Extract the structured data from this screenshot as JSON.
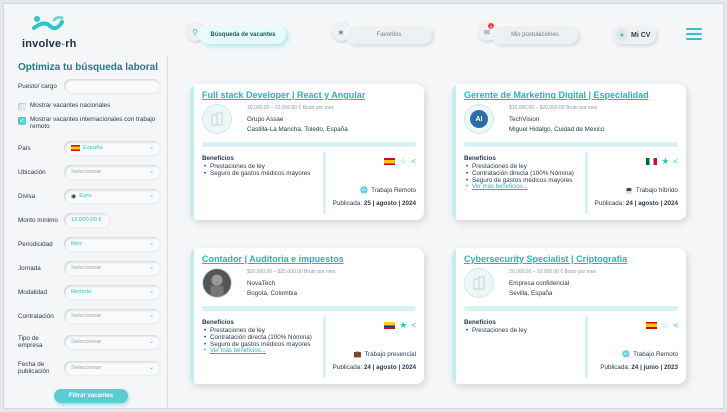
{
  "header": {
    "logo_text": "involve-rh",
    "nav": [
      {
        "label": "Búsqueda de vacantes"
      },
      {
        "label": "Favoritos"
      },
      {
        "label": "Mis postulaciones",
        "badge": "1"
      }
    ],
    "profile_label": "Mi CV"
  },
  "sidebar": {
    "title": "Optimiza tu búsqueda laboral",
    "position_label": "Puesto/ cargo",
    "position_value": "",
    "national_label": "Mostrar vacantes nacionales",
    "international_label": "Mostrar vacantes internacionales con trabajo remoto",
    "country_label": "País",
    "country_value": "España",
    "location_label": "Ubicación",
    "location_value": "Seleccionar",
    "currency_label": "Divisa",
    "currency_value": "Euro",
    "min_amount_label": "Monto mínimo",
    "min_amount_value": "15,000.00 €",
    "periodicity_label": "Periodicidad",
    "periodicity_value": "Mes",
    "shift_label": "Jornada",
    "shift_value": "Seleccionar",
    "modality_label": "Modalidad",
    "modality_value": "Remoto",
    "contract_label": "Contratación",
    "contract_value": "Seleccionar",
    "company_type_label": "Tipo de empresa",
    "company_type_value": "Seleccionar",
    "pub_date_label": "Fecha de publicación",
    "pub_date_value": "Seleccionar",
    "filter_button": "Filtrar vacantes"
  },
  "jobs": [
    {
      "title": "Full stack Developer | React y Angular",
      "salary": "10,000.00 – 20,000.00 € Bruto por mes",
      "company": "Grupo Assae",
      "location": "Castilla-La Mancha, Toledo, España",
      "benefits_title": "Beneficios",
      "benefits": [
        "Prestaciones de ley",
        "Seguro de gastos médicos mayores"
      ],
      "more": "",
      "modality": "Trabajo Remoto",
      "published_label": "Publicada:",
      "published_date": "25 | agosto | 2024",
      "favorite": false
    },
    {
      "title": "Gerente de Marketing Digital | Especialidad",
      "salary": "$15,000.00 – $20,000.00 Bruto por mes",
      "company": "TechVision",
      "location": "Miguel Hidalgo, Cuidad de México",
      "benefits_title": "Beneficios",
      "benefits": [
        "Prestaciones de ley",
        "Contratación directa (100% Nómina)",
        "Seguro de gastos médicos mayores"
      ],
      "more": "Ver más beneficios...",
      "modality": "Trabajo híbrido",
      "published_label": "Publicada:",
      "published_date": "24 | agosto | 2024",
      "favorite": true
    },
    {
      "title": "Contador | Auditoria e impuestos",
      "salary": "$20,000.00 – $25,000.00 Bruto por mes",
      "company": "NovaTech",
      "location": "Bogotá, Colombia",
      "benefits_title": "Beneficios",
      "benefits": [
        "Prestaciones de ley",
        "Contratación directa (100% Nómina)",
        "Seguro de gastos médicos mayores"
      ],
      "more": "Ver más beneficios...",
      "modality": "Trabajo presencial",
      "published_label": "Publicada:",
      "published_date": "24 | agosto | 2024",
      "favorite": true
    },
    {
      "title": "Cybersecurity Specialist | Criptografía",
      "salary": "20,000.00 – 30,000.00 € Bruto por mes",
      "company": "Empresa confidencial",
      "location": "Sevilla, España",
      "benefits_title": "Beneficios",
      "benefits": [
        "Prestaciones de ley"
      ],
      "more": "",
      "modality": "Trabajo Remoto",
      "published_label": "Publicada:",
      "published_date": "24 | junio | 2023",
      "favorite": false
    }
  ],
  "icons": {
    "star_outline": "☆",
    "star_filled": "★",
    "share": "<",
    "globe": "🌐",
    "laptop": "💻",
    "briefcase": "💼"
  },
  "colors": {
    "accent": "#2ec4c9",
    "title": "#2ab3ba",
    "sidebar_title": "#1f7f88"
  }
}
